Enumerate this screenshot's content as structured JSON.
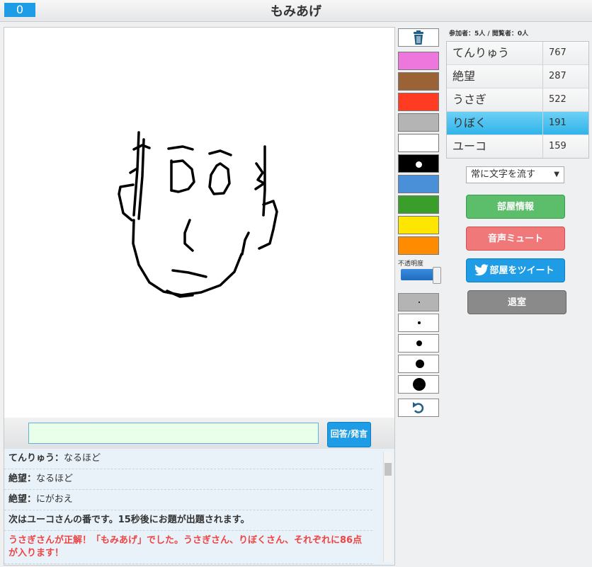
{
  "header": {
    "counter": "0",
    "title": "もみあげ"
  },
  "answer": {
    "placeholder": "",
    "button_label": "回答/発言"
  },
  "chat": [
    {
      "name": "てんりゅう：",
      "text": "なるほど",
      "type": "user"
    },
    {
      "name": "絶望：",
      "text": "なるほど",
      "type": "user"
    },
    {
      "name": "絶望：",
      "text": "にがおえ",
      "type": "user"
    },
    {
      "name": "",
      "text": "次はユーコさんの番です。15秒後にお題が出題されます。",
      "type": "sys"
    },
    {
      "name": "",
      "text": "うさぎさんが正解！「もみあげ」でした。うさぎさん、りぼくさん、それぞれに86点が入ります！",
      "type": "red"
    }
  ],
  "tools": {
    "colors": [
      "#ee77dd",
      "#9b6236",
      "#ff3b22",
      "#b4b4b4",
      "#ffffff",
      "#000000",
      "#4a90d9",
      "#3a9e2a",
      "#ffe600",
      "#ff8c00"
    ],
    "selected_color": "#000000",
    "opacity_label": "不透明度",
    "opacity": 1.0,
    "trash_icon": "trash-icon",
    "undo_icon": "undo-icon"
  },
  "room": {
    "participants_text": "参加者：5人 / 閲覧者：0人",
    "scores": [
      {
        "name": "てんりゅう",
        "score": "767"
      },
      {
        "name": "絶望",
        "score": "287"
      },
      {
        "name": "うさぎ",
        "score": "522"
      },
      {
        "name": "りぼく",
        "score": "191",
        "active": true
      },
      {
        "name": "ユーコ",
        "score": "159"
      }
    ],
    "select_value": "常に文字を流す",
    "buttons": {
      "info": "部屋情報",
      "mute": "音声ミュート",
      "tweet": "部屋をツイート",
      "exit": "退室"
    }
  }
}
